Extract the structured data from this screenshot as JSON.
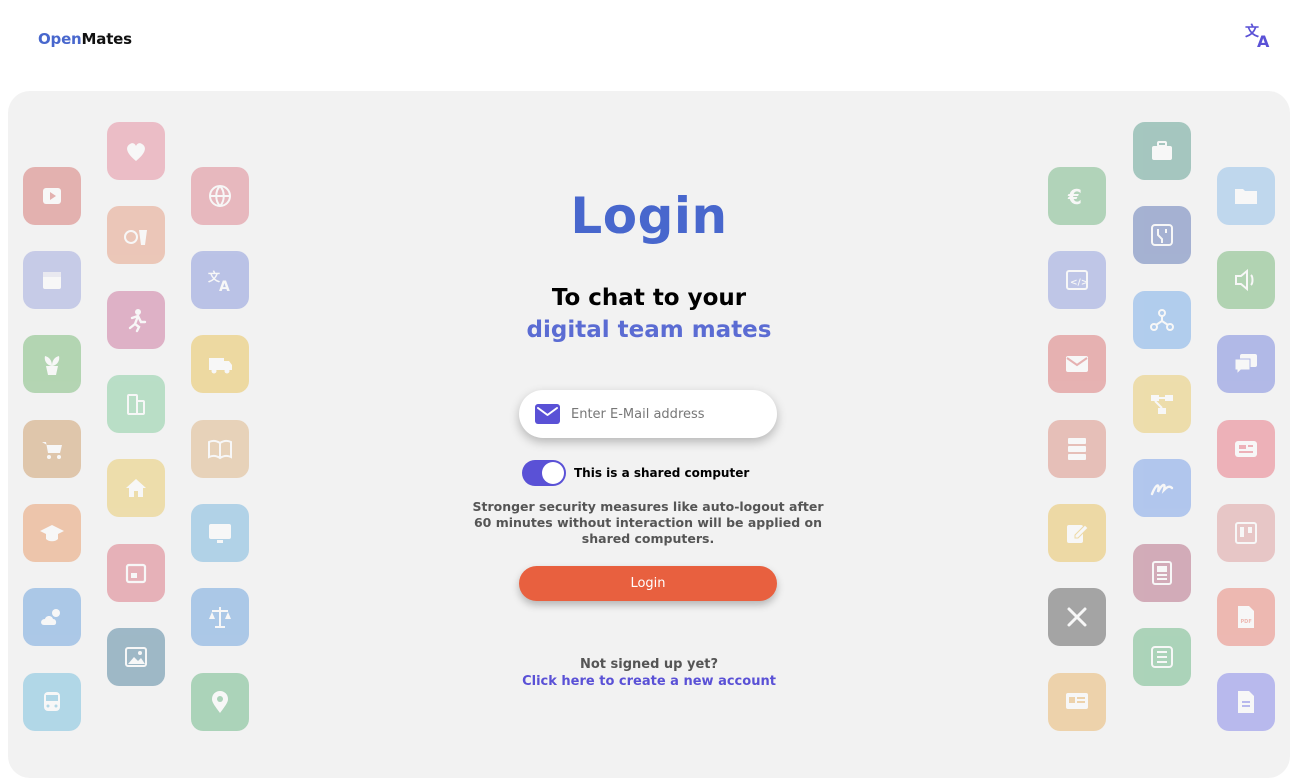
{
  "header": {
    "brand_open": "Open",
    "brand_mates": "Mates",
    "language_icon": "translate-icon"
  },
  "login": {
    "title": "Login",
    "subtitle_line1": "To chat to your",
    "subtitle_line2": "digital team mates",
    "email_placeholder": "Enter E-Mail address",
    "email_value": "",
    "shared_label": "This is a shared computer",
    "shared_enabled": true,
    "security_notice": "Stronger security measures like auto-logout after 60 minutes without interaction will be applied on shared computers.",
    "login_button": "Login",
    "signup_question": "Not signed up yet?",
    "signup_link": "Click here to create a new account"
  },
  "colors": {
    "accent": "#4867CD",
    "toggle": "#5a51d6",
    "login_button": "#e8603f",
    "card_background": "#f2f2f2"
  },
  "background_icons": [
    "play-icon",
    "heart-icon",
    "globe-icon",
    "fruit-drink-icon",
    "calendar-icon",
    "translate-icon",
    "running-icon",
    "plant-icon",
    "truck-icon",
    "building-icon",
    "cart-icon",
    "book-icon",
    "home-icon",
    "graduation-icon",
    "monitor-icon",
    "event-calendar-icon",
    "weather-icon",
    "scales-icon",
    "image-icon",
    "bus-icon",
    "map-pin-icon",
    "briefcase-icon",
    "euro-icon",
    "folder-icon",
    "circuit-icon",
    "code-icon",
    "speaker-icon",
    "network-icon",
    "mail-icon",
    "chat-icon",
    "workflow-icon",
    "server-icon",
    "news-icon",
    "signature-icon",
    "edit-icon",
    "kanban-icon",
    "document-icon",
    "design-tools-icon",
    "pdf-icon",
    "list-icon",
    "presentation-icon",
    "file-icon"
  ]
}
